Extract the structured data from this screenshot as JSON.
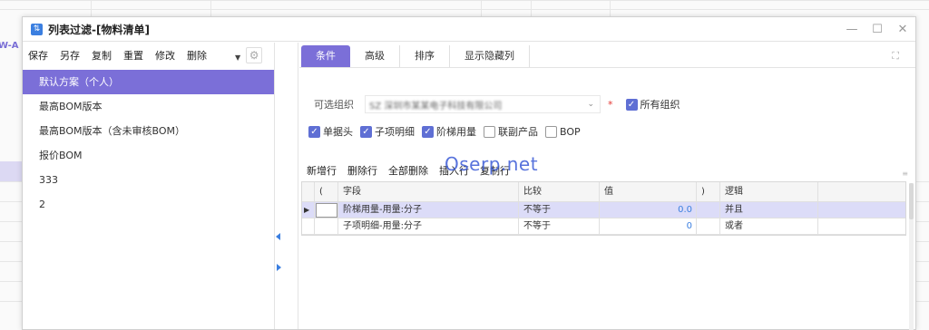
{
  "background": {
    "left_label": "W-A"
  },
  "window": {
    "title": "列表过滤-[物料清单]",
    "minimize": "—",
    "maximize": "☐",
    "close": "✕"
  },
  "left_toolbar": {
    "save": "保存",
    "save_as": "另存",
    "copy": "复制",
    "reset": "重置",
    "modify": "修改",
    "delete": "删除"
  },
  "schemes": [
    {
      "label": "默认方案（个人）",
      "active": true
    },
    {
      "label": "最高BOM版本",
      "active": false
    },
    {
      "label": "最高BOM版本（含未审核BOM）",
      "active": false
    },
    {
      "label": "报价BOM",
      "active": false
    },
    {
      "label": "333",
      "active": false
    },
    {
      "label": "2",
      "active": false
    }
  ],
  "tabs": [
    "条件",
    "高级",
    "排序",
    "显示隐藏列"
  ],
  "org": {
    "label": "可选组织",
    "value": "SZ 深圳市某某电子科技有限公司",
    "required_mark": "*",
    "all_orgs_label": "所有组织",
    "all_orgs_checked": true
  },
  "checks": [
    {
      "label": "单据头",
      "checked": true
    },
    {
      "label": "子项明细",
      "checked": true
    },
    {
      "label": "阶梯用量",
      "checked": true
    },
    {
      "label": "联副产品",
      "checked": false
    },
    {
      "label": "BOP",
      "checked": false
    }
  ],
  "grid_toolbar": {
    "add_row": "新增行",
    "delete_row": "删除行",
    "delete_all": "全部删除",
    "insert_row": "插入行",
    "copy_row": "复制行"
  },
  "watermark": "Oserp.net",
  "grid": {
    "headers": {
      "lparen": "(",
      "field": "字段",
      "compare": "比较",
      "value": "值",
      "rparen": ")",
      "logic": "逻辑"
    },
    "rows": [
      {
        "field": "阶梯用量-用量:分子",
        "compare": "不等于",
        "value": "0.0",
        "logic": "并且",
        "selected": true
      },
      {
        "field": "子项明细-用量:分子",
        "compare": "不等于",
        "value": "0",
        "logic": "或者",
        "selected": false
      }
    ]
  },
  "colors": {
    "accent": "#7b6fd8",
    "checkbox": "#5f6fd4",
    "link": "#3b7fe0"
  }
}
